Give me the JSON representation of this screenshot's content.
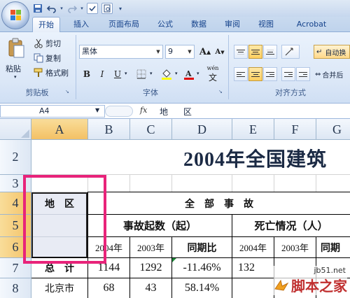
{
  "window": {
    "tabs": [
      "开始",
      "插入",
      "页面布局",
      "公式",
      "数据",
      "审阅",
      "视图",
      "Acrobat"
    ],
    "active_tab": "开始"
  },
  "ribbon": {
    "clipboard": {
      "paste_label": "粘贴",
      "cut_label": "剪切",
      "copy_label": "复制",
      "format_painter_label": "格式刷",
      "group_label": "剪贴板"
    },
    "font": {
      "font_name": "黑体",
      "font_size": "9",
      "group_label": "字体",
      "bold": "B",
      "italic": "I",
      "underline": "U",
      "grow": "A",
      "shrink": "A",
      "phonetic": "wén"
    },
    "alignment": {
      "wrap_label": "自动换",
      "merge_label": "合并后",
      "group_label": "对齐方式"
    }
  },
  "formula_bar": {
    "name_box": "A4",
    "fx": "fx",
    "content": "地 区"
  },
  "grid": {
    "columns": [
      "A",
      "B",
      "C",
      "D",
      "E",
      "F",
      "G"
    ],
    "selected_column": "A",
    "rows": [
      "2",
      "3",
      "4",
      "5",
      "6",
      "7",
      "8"
    ],
    "selected_rows": [
      "4",
      "5",
      "6"
    ],
    "title": "2004年全国建筑",
    "a4_text": "地    区",
    "header_all": "全    部    事    故",
    "accident_count": "事故起数（起）",
    "deaths": "死亡情况（人）",
    "year_2004": "2004年",
    "year_2003": "2003年",
    "yoy": "同期比",
    "yoy_partial": "同期",
    "row7": [
      "总    计",
      "1144",
      "1292",
      "-11.46%",
      "132"
    ],
    "row8": [
      "北京市",
      "68",
      "43",
      "58.14%"
    ]
  },
  "watermark": {
    "site": "jb51.net",
    "name": "脚本之家"
  },
  "colors": {
    "highlight": "#e8237a",
    "ribbon_bg": "#dbe7f7",
    "selected_header": "#f3c165"
  }
}
